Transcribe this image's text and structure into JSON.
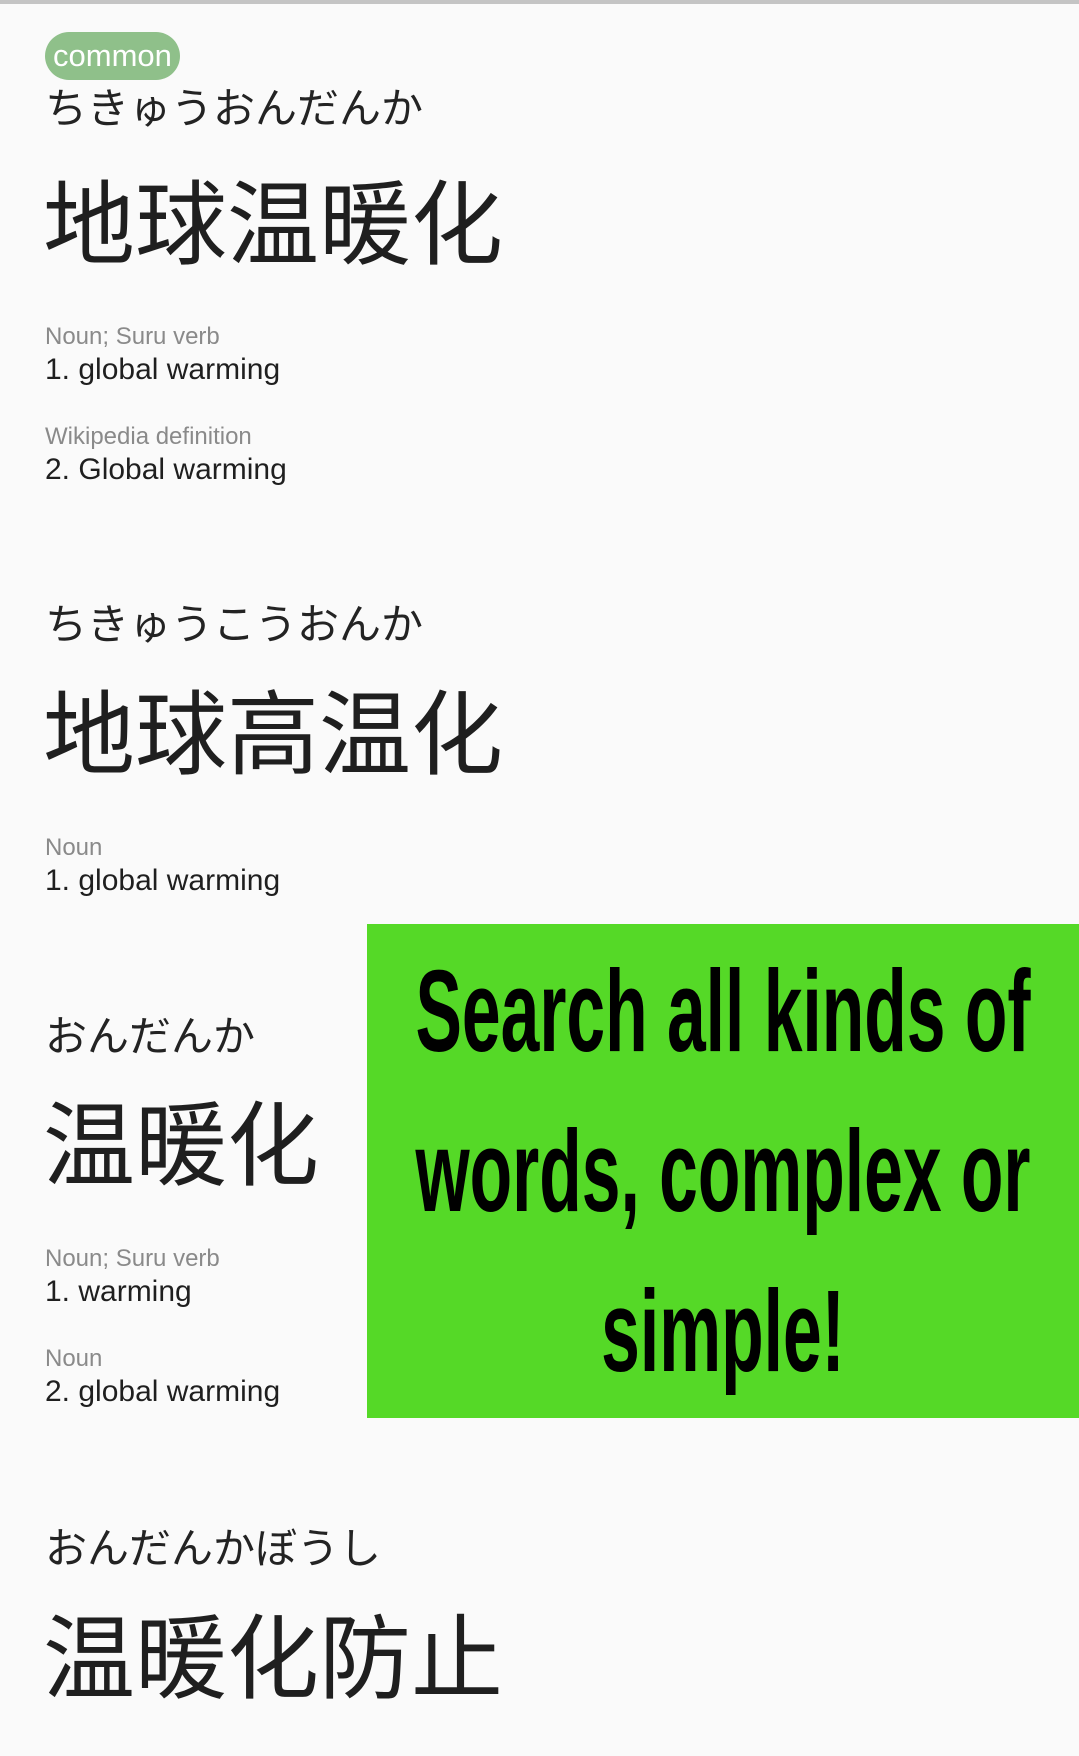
{
  "entries": [
    {
      "badge": "common",
      "reading": "ちきゅうおんだんか",
      "kanji": "地球温暖化",
      "senses": [
        {
          "pos": "Noun; Suru verb",
          "definition": "1. global warming"
        },
        {
          "pos": "Wikipedia definition",
          "definition": "2. Global warming"
        }
      ]
    },
    {
      "reading": "ちきゅうこうおんか",
      "kanji": "地球高温化",
      "senses": [
        {
          "pos": "Noun",
          "definition": "1. global warming"
        }
      ]
    },
    {
      "reading": "おんだんか",
      "kanji": "温暖化",
      "senses": [
        {
          "pos": "Noun; Suru verb",
          "definition": "1. warming"
        },
        {
          "pos": "Noun",
          "definition": "2. global warming"
        }
      ]
    },
    {
      "reading": "おんだんかぼうし",
      "kanji": "温暖化防止"
    }
  ],
  "promo": {
    "text": "Search all kinds of words, complex or simple!",
    "background": "#55d927"
  },
  "colors": {
    "badge": "#8fc08a",
    "pos": "#8a8a8a",
    "text": "#1f1f1f"
  }
}
